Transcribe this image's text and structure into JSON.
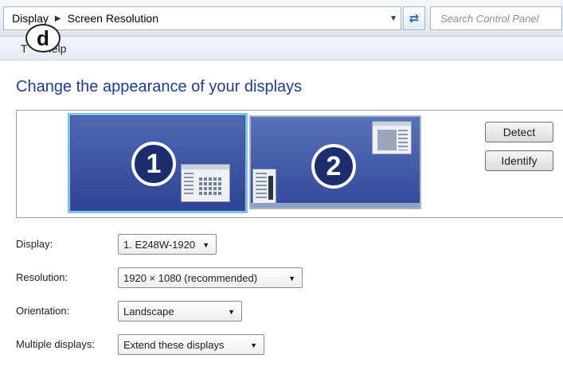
{
  "address_bar": {
    "crumbs": [
      "Display",
      "Screen Resolution"
    ],
    "search_placeholder": "Search Control Panel"
  },
  "menu": {
    "tools": "T",
    "help": "Help"
  },
  "badge": "d",
  "page_title": "Change the appearance of your displays",
  "monitors": {
    "monitor1_number": "1",
    "monitor2_number": "2"
  },
  "buttons": {
    "detect": "Detect",
    "identify": "Identify"
  },
  "settings": {
    "display": {
      "label": "Display:",
      "value": "1. E248W-1920"
    },
    "resolution": {
      "label": "Resolution:",
      "value": "1920 × 1080 (recommended)"
    },
    "orientation": {
      "label": "Orientation:",
      "value": "Landscape"
    },
    "multiple_displays": {
      "label": "Multiple displays:",
      "value": "Extend these displays"
    }
  },
  "colors": {
    "title": "#1e3d8f",
    "monitor": "#3a50a0",
    "selection_glow": "#7fc2ef"
  }
}
